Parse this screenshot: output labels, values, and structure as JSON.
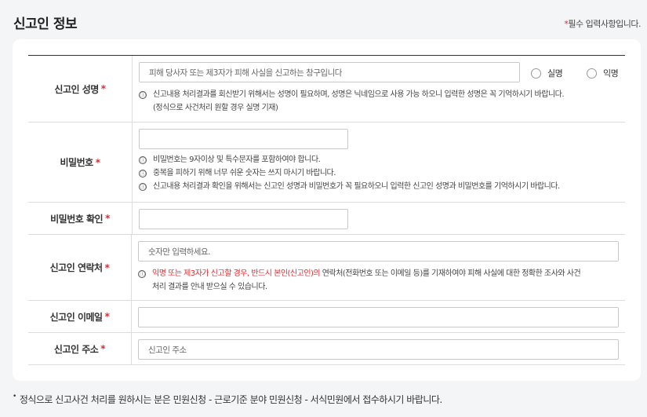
{
  "header": {
    "title": "신고인 정보",
    "required_marker": "*",
    "required_text": "필수 입력사항입니다."
  },
  "required_star": "*",
  "info_icon": "ⓘ",
  "fields": {
    "name": {
      "label": "신고인 성명",
      "placeholder": "피해 당사자 또는 제3자가 피해 사실을 신고하는 창구입니다",
      "radio_real": "실명",
      "radio_anon": "익명",
      "note_1": "신고내용 처리결과를 회신받기 위해서는 성명이 필요하며, 성명은 닉네임으로 사용 가능 하오니 입력한 성명은 꼭 기억하시기 바랍니다.",
      "note_1b": "(정식으로 사건처리 원할 경우 실명 기재)"
    },
    "password": {
      "label": "비밀번호",
      "value": "",
      "notes": [
        "비밀번호는 9자이상 및 특수문자를 포함하여야 합니다.",
        "중복을 피하기 위해 너무 쉬운 숫자는 쓰지 마시기 바랍니다.",
        "신고내용 처리결과 확인을 위해서는 신고인 성명과 비밀번호가 꼭 필요하오니 입력한 신고인 성명과 비밀번호를 기억하시기 바랍니다."
      ]
    },
    "password_confirm": {
      "label": "비밀번호 확인",
      "value": ""
    },
    "contact": {
      "label": "신고인 연락처",
      "placeholder": "숫자만 입력하세요.",
      "note_red": "익명 또는 제3자가 신고할 경우, 반드시 본인(신고인)의",
      "note_rest": " 연락처(전화번호 또는 이메일 등)를 기재하여야 피해 사실에 대한 정확한 조사와 사건",
      "note_line2": "처리 결과를 안내 받으실 수 있습니다."
    },
    "email": {
      "label": "신고인 이메일",
      "value": ""
    },
    "address": {
      "label": "신고인 주소",
      "placeholder": "신고인 주소"
    }
  },
  "footer": {
    "bullet": "•",
    "text": "정식으로 신고사건 처리를 원하시는 분은 민원신청 - 근로기준 분야 민원신청 - 서식민원에서 접수하시기 바랍니다."
  },
  "colors": {
    "required_red": "#e0292f",
    "page_bg": "#f4f5f7",
    "card_bg": "#ffffff",
    "border": "#dcdcdc"
  }
}
